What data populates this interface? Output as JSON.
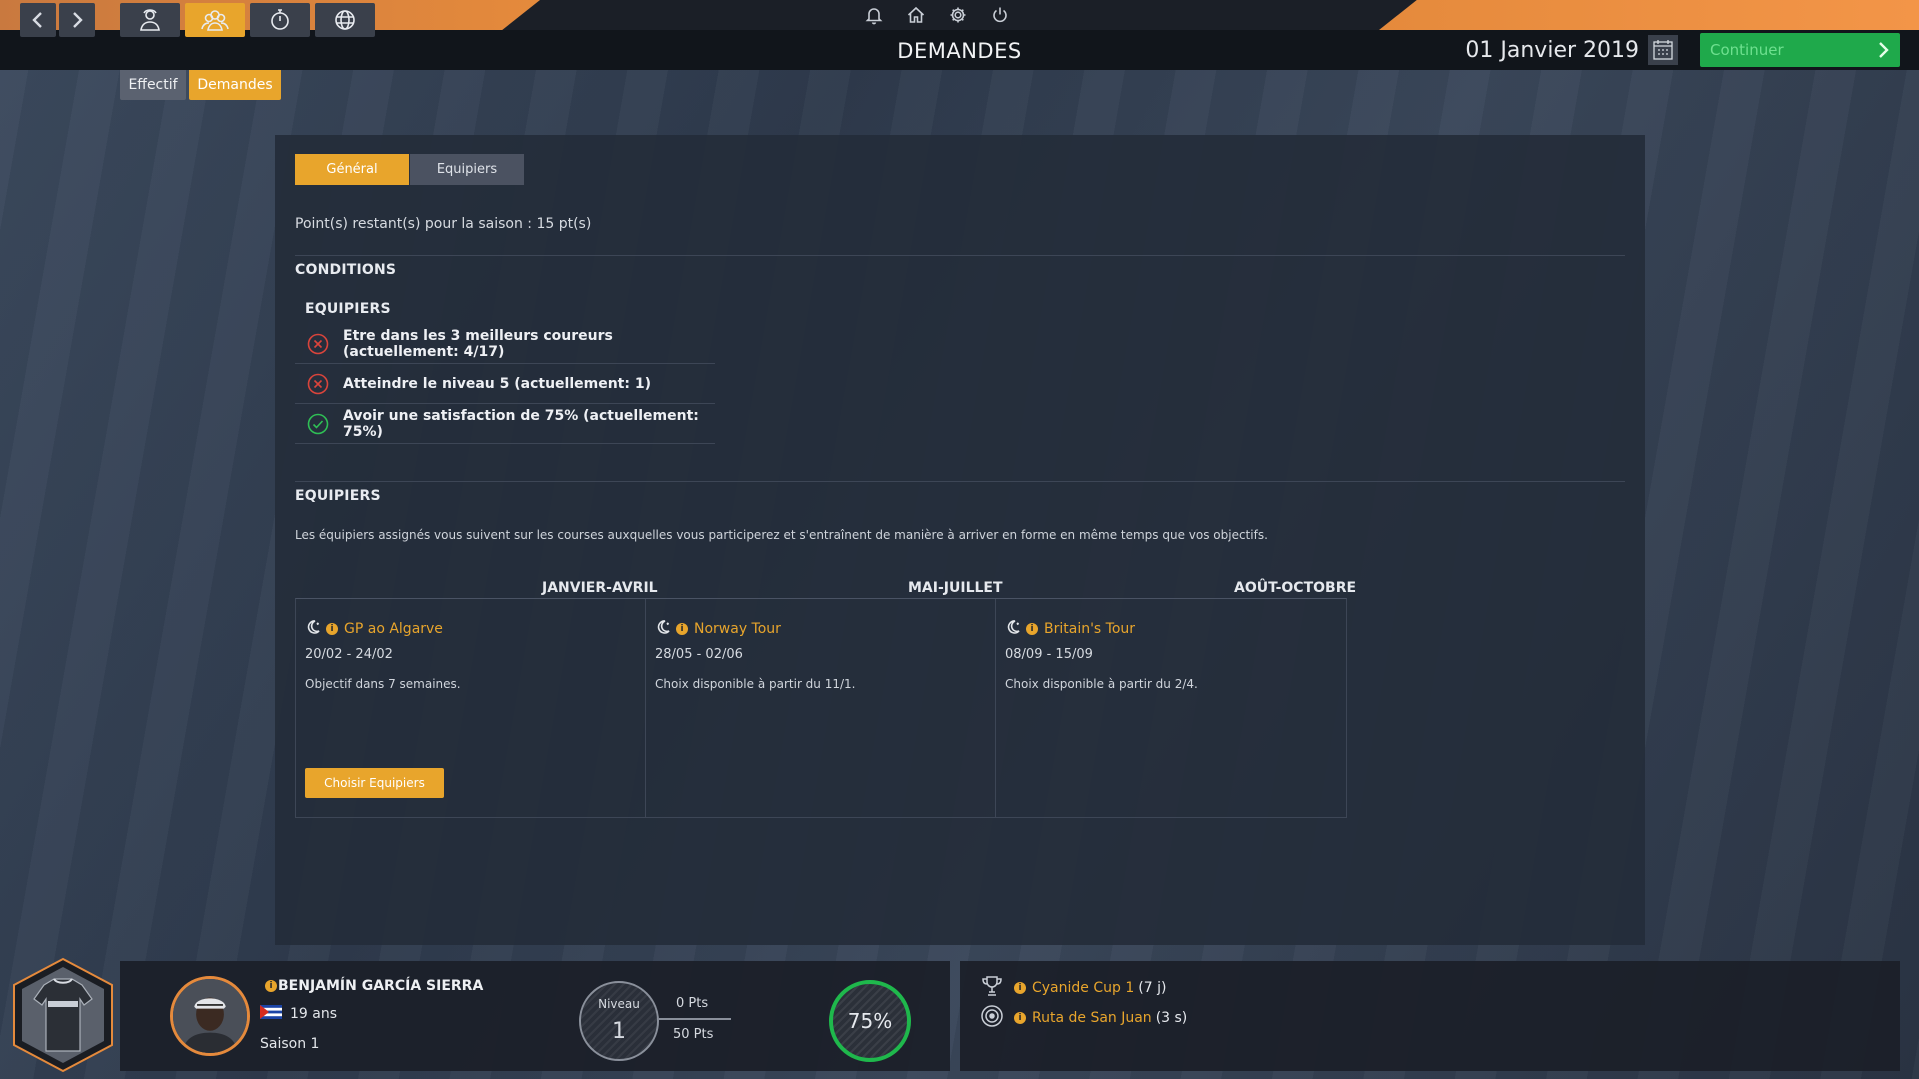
{
  "header": {
    "title": "DEMANDES",
    "date": "01 Janvier 2019",
    "continue_label": "Continuer",
    "sub_tabs": [
      "Effectif",
      "Demandes"
    ]
  },
  "top_icons": [
    "bell-icon",
    "home-icon",
    "gear-icon",
    "power-icon"
  ],
  "panel": {
    "tabs": [
      "Général",
      "Equipiers"
    ],
    "points_text": "Point(s) restant(s) pour la saison : 15 pt(s)",
    "conditions_title": "CONDITIONS",
    "conditions_sub_title": "EQUIPIERS",
    "conditions": [
      {
        "text": "Etre dans les 3 meilleurs coureurs (actuellement: 4/17)",
        "status": "failed"
      },
      {
        "text": "Atteindre le niveau 5 (actuellement: 1)",
        "status": "failed"
      },
      {
        "text": "Avoir une satisfaction de 75% (actuellement: 75%)",
        "status": "ok"
      }
    ],
    "equipiers_title": "EQUIPIERS",
    "equipiers_desc": "Les équipiers assignés vous suivent sur les courses auxquelles vous participerez et s'entraînent de manière à arriver en forme en même temps que vos objectifs.",
    "periods": [
      {
        "label": "JANVIER-AVRIL",
        "race": "GP ao Algarve",
        "dates": "20/02 - 24/02",
        "note": "Objectif dans 7 semaines.",
        "button": "Choisir Equipiers"
      },
      {
        "label": "MAI-JUILLET",
        "race": "Norway Tour",
        "dates": "28/05 - 02/06",
        "note": "Choix disponible à partir du 11/1."
      },
      {
        "label": "AOÛT-OCTOBRE",
        "race": "Britain's Tour",
        "dates": "08/09 - 15/09",
        "note": "Choix disponible à partir du 2/4."
      }
    ]
  },
  "rider": {
    "name": "BENJAMÍN GARCÍA SIERRA",
    "age": "19 ans",
    "season": "Saison 1",
    "level_label": "Niveau",
    "level": "1",
    "pts_current": "0 Pts",
    "pts_needed": "50 Pts",
    "satisfaction": "75%"
  },
  "objectives": [
    {
      "icon": "trophy-icon",
      "name": "Cyanide Cup 1",
      "extra": "(7 j)"
    },
    {
      "icon": "target-icon",
      "name": "Ruta de San Juan",
      "extra": "(3 s)"
    }
  ],
  "colors": {
    "accent": "#e8a52c",
    "continue": "#1fa94b",
    "ok": "#2fbf55",
    "fail": "#d9443b"
  }
}
